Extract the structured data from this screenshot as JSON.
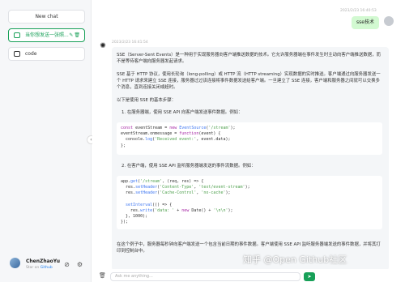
{
  "sidebar": {
    "new_chat": "New chat",
    "sessions": [
      {
        "label": "当你想发送一张照..."
      },
      {
        "label": "code"
      }
    ],
    "user": {
      "name": "ChenZhaoYu",
      "sub_prefix": "Star on ",
      "sub_link": "Github"
    }
  },
  "chat": {
    "user_time": "2023/2/23 16:40:53",
    "user_msg": "sse技术",
    "bot_time": "2023/2/23 16:41:54",
    "p1": "SSE（Server-Sent Events）是一种用于实现服务器向客户端推送数据的技术。它允许服务器端在事件发生时主动向客户端推送数据，而不是等待客户端向服务器发起请求。",
    "p2": "SSE 基于 HTTP 协议，使用长轮询（long-polling）或 HTTP 流（HTTP streaming）实现数据的实时推送。客户端通过向服务器发送一个 HTTP 请求来建立 SSE 连接，服务器过过该连接将事件数据发送给客户端。一旦建立了 SSE 连接，客户端和服务器之间就可以交换多个消息，直到连接关闭或超时。",
    "p3": "以下是使用 SSE 的基本步骤：",
    "step1": "1. 在服务器端，使用 SSE API 向客户端发送事件数据。例如：",
    "code1": [
      "const eventStream = new EventSource('/stream');",
      "eventStream.onmessage = function(event) {",
      "  console.log('Received event:', event.data);",
      "};"
    ],
    "step2": "2. 在客户端，使用 SSE API 监听服务器端发送的事件流数据。例如：",
    "code2": [
      "app.get('/stream', (req, res) => {",
      "  res.setHeader('Content-Type', 'text/event-stream');",
      "  res.setHeader('Cache-Control', 'no-cache');",
      "",
      "  setInterval(() => {",
      "    res.write('data: ' + new Date() + '\\n\\n');",
      "  }, 1000);",
      "});"
    ],
    "p4": "在这个例子中，服务器每秒钟向客户端发送一个包含当前日期的事件数据。客户端使用 SSE API 监听服务器端发送的事件数据，并将其打印到控制台中。"
  },
  "input": {
    "placeholder": "Ask me anything..."
  },
  "watermark": "知乎 @Open Github社区",
  "colors": {
    "accent": "#18a058",
    "user_bubble": "#d2f9d1",
    "bot_bubble": "#f4f6f8"
  }
}
